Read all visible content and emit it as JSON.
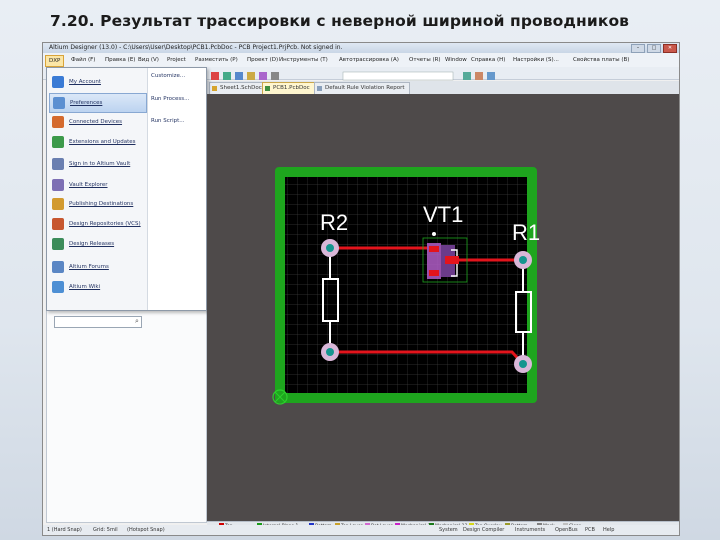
{
  "slide": {
    "title": "7.20. Результат трассировки с неверной шириной проводников"
  },
  "window": {
    "title": "Altium Designer (13.0) - C:\\Users\\User\\Desktop\\PCB1.PcbDoc - PCB Project1.PrjPcb. Not signed in.",
    "controls": {
      "minimize": "–",
      "maximize": "□",
      "close": "✕"
    }
  },
  "menubar": {
    "items": [
      "DXP",
      "Файл (F)",
      "Правка (E)",
      "Вид (V)",
      "Project",
      "Разместить (P)",
      "Проект (D)",
      "Инструменты (T)",
      "Автотрассировка (A)",
      "Отчеты (R)",
      "Window",
      "Справка (H)"
    ],
    "right": [
      "Настройки (S)...",
      "Свойства платы (B)"
    ]
  },
  "tabs": [
    {
      "label": "Sheet1.SchDoc"
    },
    {
      "label": "PCB1.PcbDoc",
      "active": true
    },
    {
      "label": "Default Rule Violation Report"
    }
  ],
  "dxp_menu": {
    "left_items": [
      {
        "label": "My Account",
        "icon": "user-icon",
        "color": "#3a7bd5"
      },
      {
        "label": "Preferences",
        "icon": "preferences-icon",
        "color": "#5b8fd1",
        "highlighted": true
      },
      {
        "label": "Connected Devices",
        "icon": "devices-icon",
        "color": "#d46a2e"
      },
      {
        "label": "Extensions and Updates",
        "icon": "extensions-icon",
        "color": "#3c9a4a"
      },
      {
        "label": "Sign in to Altium Vault",
        "icon": "vault-icon",
        "color": "#6a7fb0"
      },
      {
        "label": "Vault Explorer",
        "icon": "vault-explorer-icon",
        "color": "#7d6fb4"
      },
      {
        "label": "Publishing Destinations",
        "icon": "publishing-icon",
        "color": "#d29a2f"
      },
      {
        "label": "Design Repositories (VCS)",
        "icon": "repository-icon",
        "color": "#c7572f"
      },
      {
        "label": "Design Releases",
        "icon": "releases-icon",
        "color": "#3c8c5a"
      },
      {
        "label": "Altium Forums",
        "icon": "forums-icon",
        "color": "#5a86c4"
      },
      {
        "label": "Altium Wiki",
        "icon": "wiki-icon",
        "color": "#4d8fd4"
      }
    ],
    "right_items": [
      "Customize...",
      "Run Process...",
      "Run Script..."
    ],
    "search_icon": "search-icon"
  },
  "pcb": {
    "designators": {
      "r2": "R2",
      "vt1": "VT1",
      "r1": "R1"
    },
    "colors": {
      "board_border": "#1ea51e",
      "board_bg": "#000000",
      "grid": "#3a3a3a",
      "track": "#e3141c",
      "pad": "#d9b7d8",
      "pad_hole": "#15958f",
      "component": "#ffffff",
      "vt1_body": "#b05dc7"
    }
  },
  "layers": [
    {
      "label": "Top",
      "color": "#d00000"
    },
    {
      "label": "Internal Plane 1",
      "color": "#1a9b1a"
    },
    {
      "label": "Bottom",
      "color": "#2034c8"
    },
    {
      "label": "Top Layer",
      "color": "#c9a12b"
    },
    {
      "label": "Bot Layer",
      "color": "#d26ad0"
    },
    {
      "label": "Mechanical 1",
      "color": "#c824c8"
    },
    {
      "label": "Mechanical 13",
      "color": "#1a7a1a"
    },
    {
      "label": "Top Overlay",
      "color": "#d7d719"
    },
    {
      "label": "Bottom",
      "color": "#9b9b2b"
    },
    {
      "label": "Mask",
      "color": "#808080"
    },
    {
      "label": "Clear",
      "color": "#c0c0c0"
    }
  ],
  "statusbar": {
    "left": [
      "1 (Hard Snap)",
      "Grid: 5mil",
      "(Hotspot Snap)"
    ],
    "right": [
      "System",
      "Design Compiler",
      "Instruments",
      "OpenBus",
      "PCB",
      "Help"
    ]
  }
}
